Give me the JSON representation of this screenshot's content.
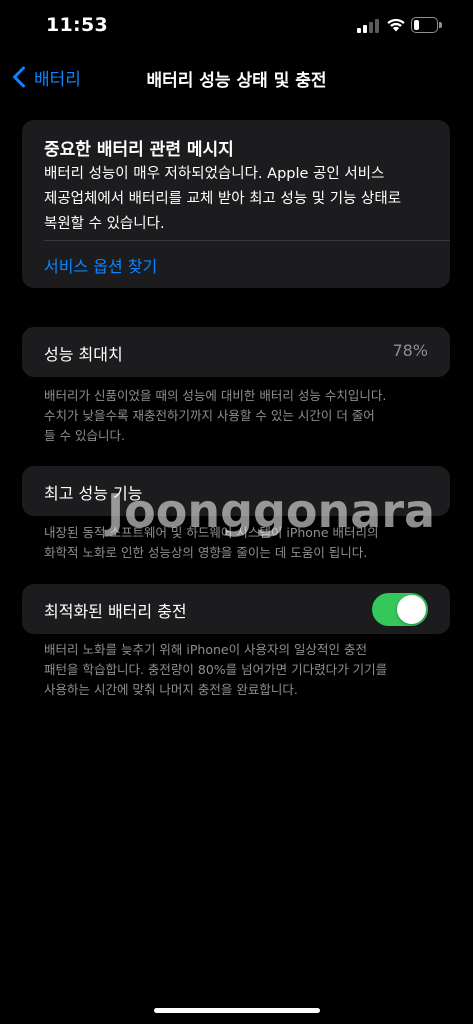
{
  "status_bar": {
    "time": "11:53",
    "battery_level": 0.25
  },
  "nav": {
    "back_label": "배터리",
    "title": "배터리 성능 상태 및 충전"
  },
  "message_card": {
    "title": "중요한 배터리 관련 메시지",
    "lines": [
      "배터리 성능이 매우 저하되었습니다. Apple 공인 서비스",
      "제공업체에서 배터리를 교체 받아 최고 성능 및 기능 상태로",
      "복원할 수 있습니다."
    ],
    "link": "서비스 옵션 찾기"
  },
  "max_capacity": {
    "label": "성능 최대치",
    "value": "78%",
    "footnote_lines": [
      "배터리가 신품이었을 때의 성능에 대비한 배터리 성능 수치입니다.",
      "수치가 낮을수록 재충전하기까지 사용할 수 있는 시간이 더 줄어",
      "들 수 있습니다."
    ]
  },
  "peak_performance": {
    "label": "최고 성능 기능",
    "footnote_lines": [
      "내장된 동적 소프트웨어 및 하드웨어 시스템이 iPhone 배터리의",
      "화학적 노화로 인한 성능상의 영향을 줄이는 데 도움이 됩니다."
    ]
  },
  "optimized_charging": {
    "label": "최적화된 배터리 충전",
    "enabled": true,
    "footnote_lines": [
      "배터리 노화를 늦추기 위해 iPhone이 사용자의 일상적인 충전",
      "패턴을 학습합니다. 충전량이 80%를 넘어가면 기다렸다가 기기를",
      "사용하는 시간에 맞춰 나머지 충전을 완료합니다."
    ]
  },
  "watermark": "Joonggonara",
  "colors": {
    "accent": "#0a84ff",
    "toggle_on": "#34c759",
    "card_bg": "#1c1c1e",
    "secondary_text": "#8e8e93"
  }
}
